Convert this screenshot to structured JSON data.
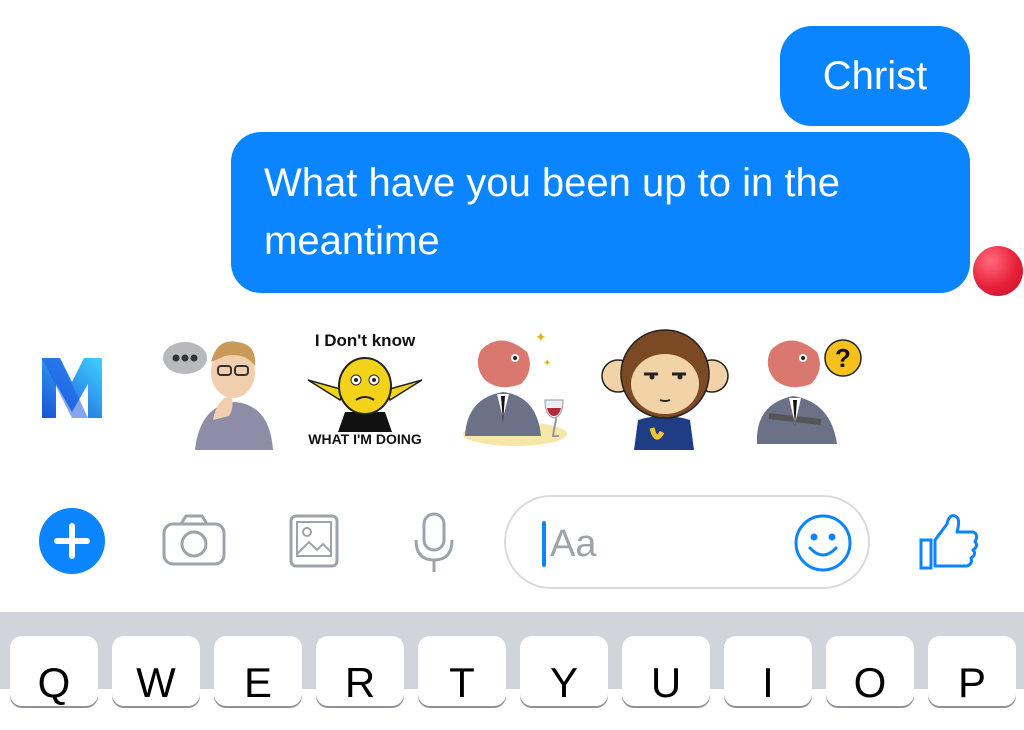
{
  "messages": [
    {
      "text": "Christ"
    },
    {
      "text": "What have you been up to in the meantime"
    }
  ],
  "stickers": {
    "assistant_icon": "messenger-m-icon",
    "items": [
      {
        "icon": "thinking-man-sticker"
      },
      {
        "icon": "yellow-face-sticker",
        "top_text": "I Don't know",
        "bottom_text": "WHAT I'M DOING"
      },
      {
        "icon": "fish-head-wine-sticker"
      },
      {
        "icon": "monkey-sticker"
      },
      {
        "icon": "fish-head-question-sticker"
      }
    ]
  },
  "composer": {
    "placeholder": "Aa",
    "icons": [
      "plus-icon",
      "camera-icon",
      "photo-icon",
      "microphone-icon",
      "emoji-icon",
      "thumbs-up-icon"
    ]
  },
  "keyboard": {
    "row1": [
      "Q",
      "W",
      "E",
      "R",
      "T",
      "Y",
      "U",
      "I",
      "O",
      "P"
    ]
  },
  "colors": {
    "bubble": "#0a84ff",
    "accent": "#0a84ff",
    "read_dot": "#e8203a",
    "keyboard_bg": "#d1d4da"
  }
}
